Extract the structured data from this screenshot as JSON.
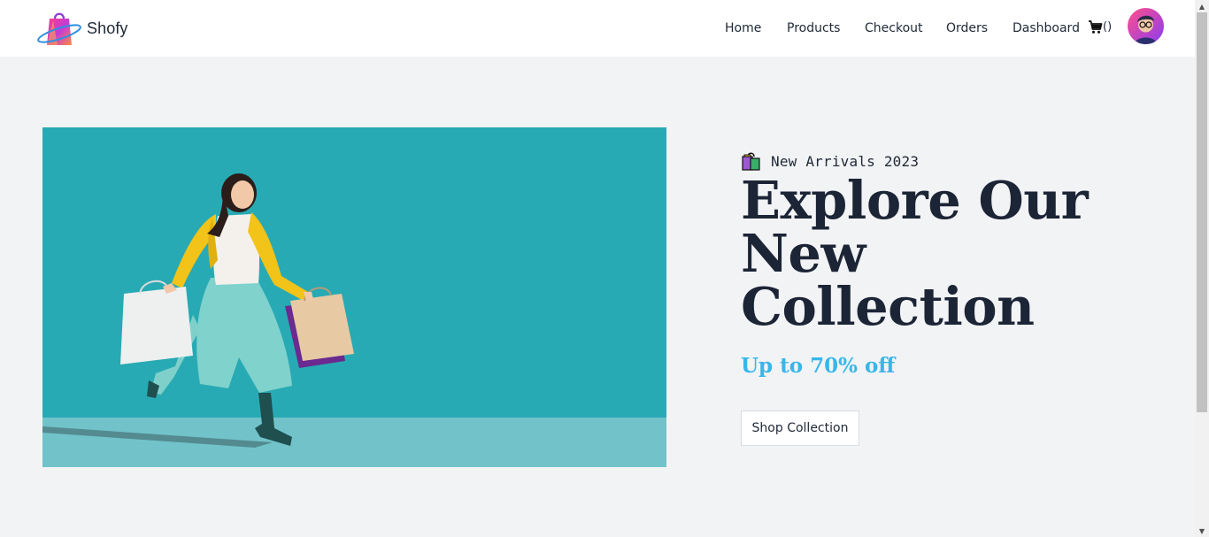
{
  "brand": {
    "name": "Shofy",
    "logo_icon": "shopping-bag-logo-icon"
  },
  "nav": {
    "items": [
      {
        "label": "Home"
      },
      {
        "label": "Products"
      },
      {
        "label": "Checkout"
      },
      {
        "label": "Orders"
      },
      {
        "label": "Dashboard"
      }
    ],
    "cart": {
      "icon": "shopping-cart-icon",
      "count_text": "()"
    },
    "avatar": {
      "icon": "user-avatar-icon"
    }
  },
  "hero": {
    "image": {
      "icon": "woman-with-shopping-bags-photo",
      "background_color": "#28aab4"
    },
    "eyebrow": {
      "icon": "shopping-bags-emoji-icon",
      "text": "New Arrivals 2023"
    },
    "headline": "Explore Our New Collection",
    "discount": "Up to 70% off",
    "cta_label": "Shop Collection"
  },
  "colors": {
    "page_background": "#f2f3f5",
    "navbar_background": "#ffffff",
    "headline": "#1c2536",
    "accent": "#38b6ea"
  },
  "scrollbar": {
    "up_glyph": "▲",
    "down_glyph": "▼"
  }
}
